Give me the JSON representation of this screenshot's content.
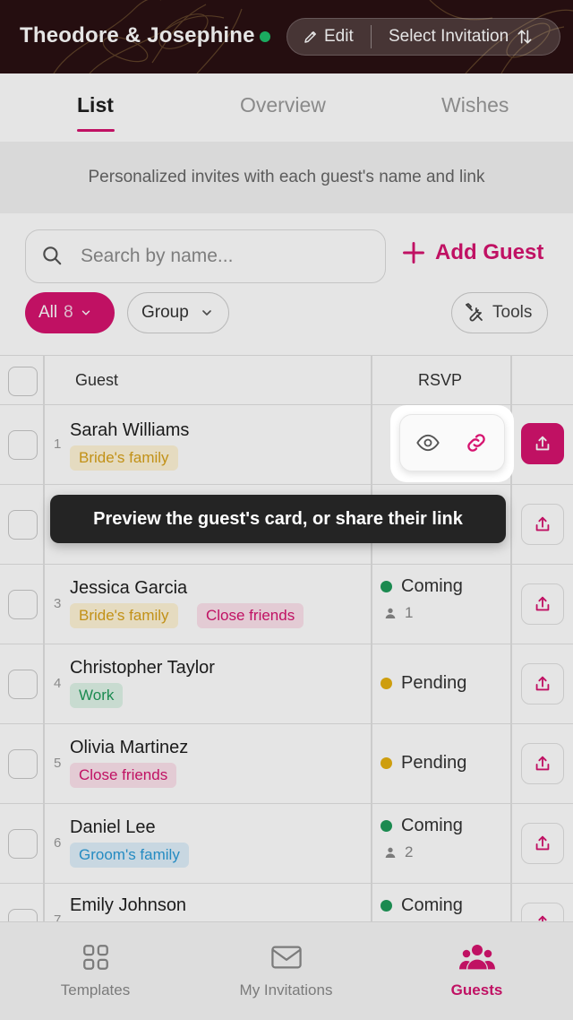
{
  "header": {
    "title": "Theodore & Josephine",
    "edit_label": "Edit",
    "select_label": "Select Invitation"
  },
  "tabs": [
    {
      "label": "List",
      "active": true
    },
    {
      "label": "Overview",
      "active": false
    },
    {
      "label": "Wishes",
      "active": false
    }
  ],
  "subtitle": "Personalized invites with each guest's name and link",
  "search": {
    "placeholder": "Search by name...",
    "value": ""
  },
  "add_guest_label": "Add Guest",
  "filters": {
    "all_label": "All",
    "all_count": "8",
    "group_label": "Group",
    "tools_label": "Tools"
  },
  "table": {
    "headers": {
      "guest": "Guest",
      "rsvp": "RSVP"
    },
    "rows": [
      {
        "num": "1",
        "name": "Sarah Williams",
        "tags": [
          "Bride's family"
        ],
        "rsvp": "",
        "party": ""
      },
      {
        "num": "2",
        "name": "",
        "tags": [],
        "rsvp": "",
        "party": ""
      },
      {
        "num": "3",
        "name": "Jessica Garcia",
        "tags": [
          "Bride's family",
          "Close friends"
        ],
        "rsvp": "Coming",
        "party": "1"
      },
      {
        "num": "4",
        "name": "Christopher Taylor",
        "tags": [
          "Work"
        ],
        "rsvp": "Pending",
        "party": ""
      },
      {
        "num": "5",
        "name": "Olivia Martinez",
        "tags": [
          "Close friends"
        ],
        "rsvp": "Pending",
        "party": ""
      },
      {
        "num": "6",
        "name": "Daniel Lee",
        "tags": [
          "Groom's family"
        ],
        "rsvp": "Coming",
        "party": "2"
      },
      {
        "num": "7",
        "name": "Emily Johnson",
        "tags": [],
        "rsvp": "Coming",
        "party": ""
      }
    ]
  },
  "tooltip": "Preview the guest's card, or share their link",
  "bottom_nav": [
    {
      "label": "Templates",
      "icon": "grid-icon",
      "active": false
    },
    {
      "label": "My Invitations",
      "icon": "envelope-icon",
      "active": false
    },
    {
      "label": "Guests",
      "icon": "people-icon",
      "active": true
    }
  ],
  "colors": {
    "accent": "#d6136f",
    "header_bg": "#2a1012",
    "status_green": "#1f9a5a",
    "status_yellow": "#e6b010"
  }
}
